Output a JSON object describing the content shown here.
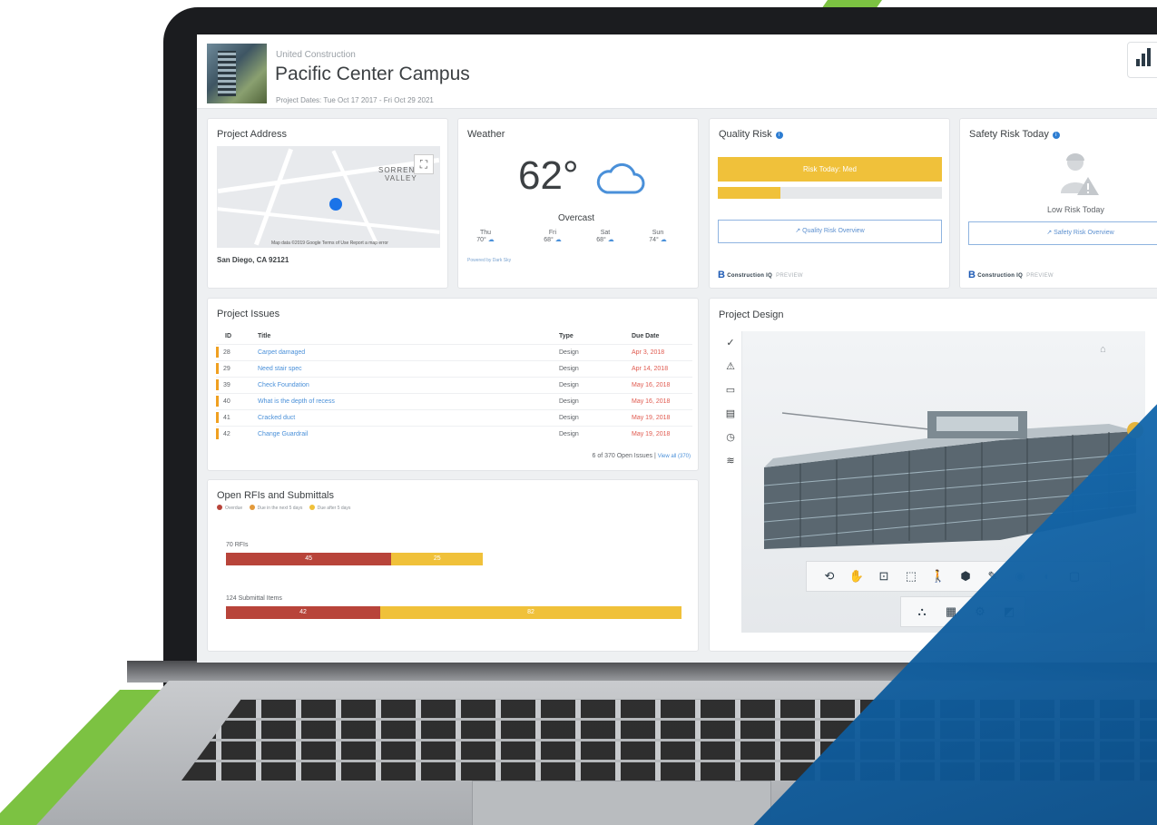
{
  "header": {
    "company": "United Construction",
    "project_title": "Pacific Center Campus",
    "project_dates": "Project Dates: Tue Oct 17 2017 - Fri Oct 29 2021"
  },
  "address": {
    "title": "Project Address",
    "address_line": "San Diego, CA 92121",
    "map_labels": [
      "SORRENTO",
      "VALLEY"
    ],
    "map_credit": "Map data ©2019 Google   Terms of Use   Report a map error"
  },
  "weather": {
    "title": "Weather",
    "temperature": "62°",
    "condition": "Overcast",
    "forecast": [
      {
        "day": "Thu",
        "temp": "70°"
      },
      {
        "day": "Fri",
        "temp": "68°"
      },
      {
        "day": "Sat",
        "temp": "68°"
      },
      {
        "day": "Sun",
        "temp": "74°"
      }
    ],
    "powered_by": "Powered by Dark Sky"
  },
  "quality_risk": {
    "title": "Quality Risk",
    "risk_label": "Risk Today: Med",
    "risk_level_fraction": 0.28,
    "overview_button": "Quality Risk Overview",
    "brand": "Construction IQ",
    "brand_badge": "PREVIEW"
  },
  "safety_risk": {
    "title": "Safety Risk Today",
    "risk_label": "Low Risk Today",
    "overview_button": "Safety Risk Overview",
    "brand": "Construction IQ",
    "brand_badge": "PREVIEW"
  },
  "issues": {
    "title": "Project Issues",
    "columns": [
      "ID",
      "Title",
      "Type",
      "Due Date"
    ],
    "rows": [
      {
        "id": "28",
        "title": "Carpet damaged",
        "type": "Design",
        "due": "Apr 3, 2018"
      },
      {
        "id": "29",
        "title": "Need stair spec",
        "type": "Design",
        "due": "Apr 14, 2018"
      },
      {
        "id": "39",
        "title": "Check Foundation",
        "type": "Design",
        "due": "May 16, 2018"
      },
      {
        "id": "40",
        "title": "What is the depth of recess",
        "type": "Design",
        "due": "May 16, 2018"
      },
      {
        "id": "41",
        "title": "Cracked duct",
        "type": "Design",
        "due": "May 19, 2018"
      },
      {
        "id": "42",
        "title": "Change Guardrail",
        "type": "Design",
        "due": "May 19, 2018"
      }
    ],
    "count_text": "6 of 370 Open Issues |",
    "view_all": "View all (370)"
  },
  "rfis": {
    "title": "Open RFIs and Submittals",
    "legend": [
      {
        "label": "Overdue",
        "color": "#b8443a"
      },
      {
        "label": "Due in the next 5 days",
        "color": "#e39a3b"
      },
      {
        "label": "Due after 5 days",
        "color": "#f0c13a"
      }
    ],
    "bars": [
      {
        "label": "70 RFIs",
        "total": 70,
        "segments": [
          {
            "value": 45,
            "color": "#b8443a"
          },
          {
            "value": 25,
            "color": "#f0c13a"
          }
        ]
      },
      {
        "label": "124 Submittal Items",
        "total": 124,
        "segments": [
          {
            "value": 42,
            "color": "#b8443a"
          },
          {
            "value": 82,
            "color": "#f0c13a"
          }
        ]
      }
    ]
  },
  "design": {
    "title": "Project Design"
  },
  "colors": {
    "accent_blue": "#4a90d9",
    "risk_yellow": "#f0c13a",
    "overdue_red": "#b8443a",
    "brand_green": "#7cc242",
    "brand_blue": "#1670b8"
  }
}
